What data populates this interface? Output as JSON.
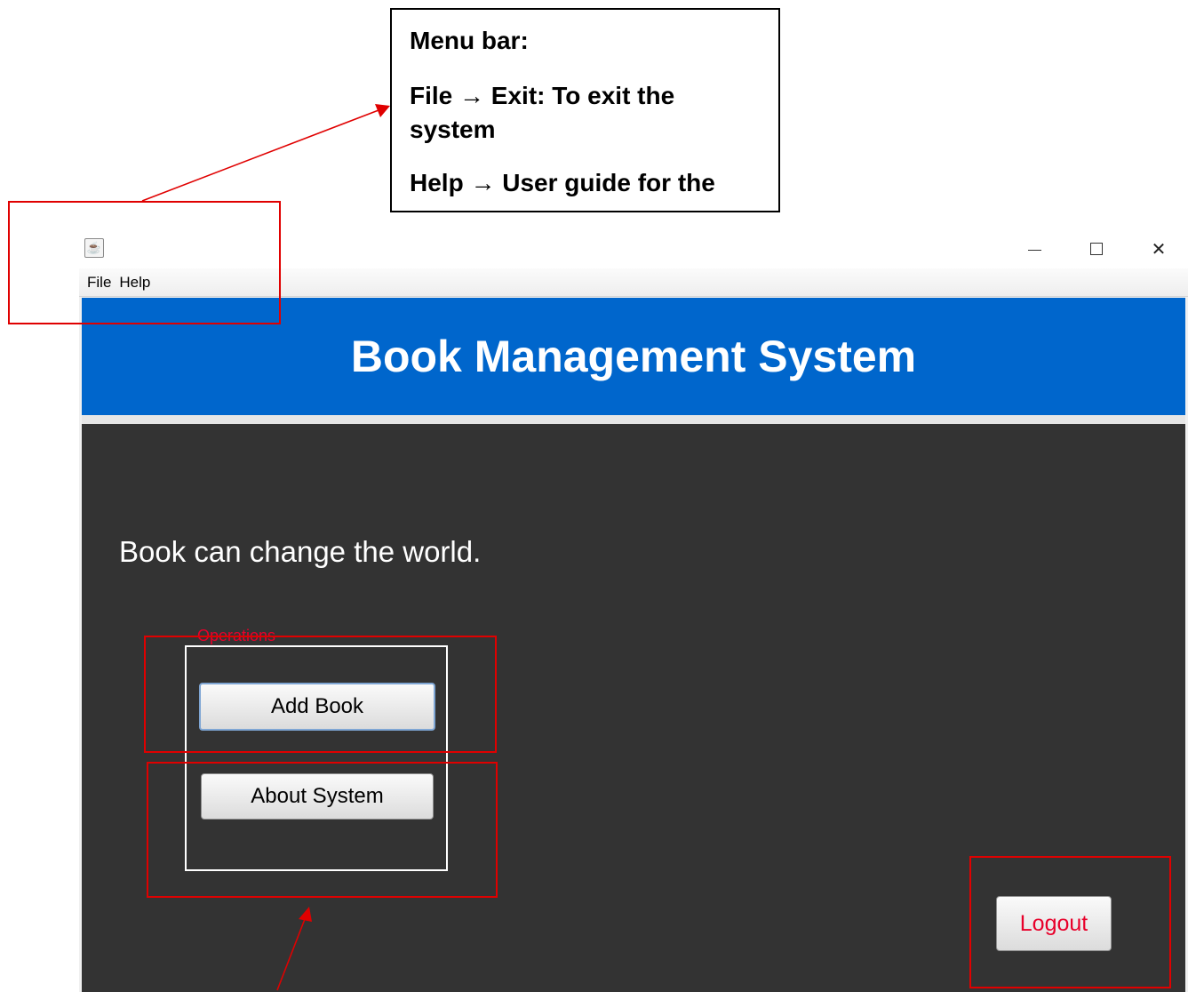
{
  "annotation": {
    "line1": "Menu bar:",
    "line2": "File → Exit: To exit the system",
    "line3": "Help → User guide for the"
  },
  "window": {
    "app_icon": "java-cup-icon",
    "minimize_icon": "minimize-icon",
    "maximize_icon": "maximize-icon",
    "close_icon": "close-icon",
    "close_glyph": "✕"
  },
  "menu": {
    "file": "File",
    "help": "Help"
  },
  "header": {
    "title": "Book Management System"
  },
  "main": {
    "motto": "Book can change the world.",
    "operations": {
      "title": "Operations",
      "add_book": "Add Book",
      "about_system": "About System"
    },
    "logout": "Logout"
  },
  "colors": {
    "header_blue": "#0066cc",
    "content_dark": "#333333",
    "accent_red": "#e8002a",
    "annotation_red": "#e00000"
  }
}
